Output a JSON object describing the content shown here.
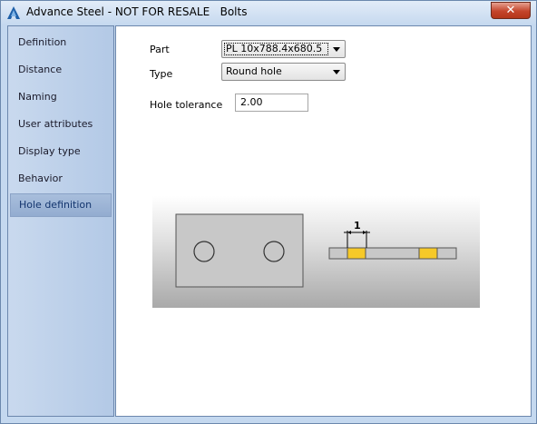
{
  "window": {
    "title": "Advance Steel - NOT FOR RESALE   Bolts",
    "close_icon_text": "✕"
  },
  "sidebar": {
    "items": [
      {
        "label": "Definition",
        "active": false
      },
      {
        "label": "Distance",
        "active": false
      },
      {
        "label": "Naming",
        "active": false
      },
      {
        "label": "User attributes",
        "active": false
      },
      {
        "label": "Display type",
        "active": false
      },
      {
        "label": "Behavior",
        "active": false
      },
      {
        "label": "Hole definition",
        "active": true
      }
    ]
  },
  "form": {
    "part_label": "Part",
    "part_value": "PL 10x788.4x680.5",
    "type_label": "Type",
    "type_value": "Round hole",
    "tolerance_label": "Hole tolerance",
    "tolerance_value": "2.00"
  },
  "diagram": {
    "dimension_label": "1",
    "colors": {
      "plate": "#c8c8c8",
      "hole_outline": "#333333",
      "bolt_fill": "#f6c928"
    }
  },
  "theme": {
    "accent": "#93acd0",
    "window_bg": "#c4d8ef",
    "close_red": "#c4452b"
  }
}
